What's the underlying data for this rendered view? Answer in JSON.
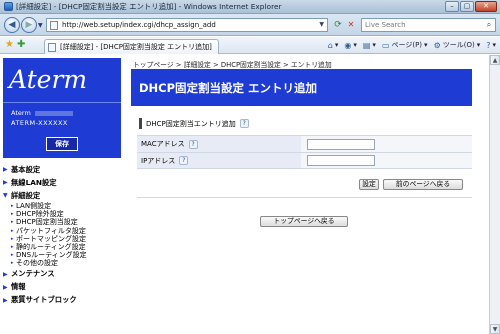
{
  "window": {
    "title": "[詳細設定] - [DHCP固定割当設定 エントリ追加] - Windows Internet Explorer",
    "minimize": "–",
    "maximize": "▢",
    "close": "✕"
  },
  "address": {
    "url": "http://web.setup/index.cgi/dhcp_assign_add",
    "search_placeholder": "Live Search"
  },
  "tab": {
    "label": "[詳細設定] - [DHCP固定割当設定 エントリ追加]"
  },
  "cmdbar": {
    "page": "ページ(P)",
    "tools": "ツール(O)"
  },
  "sidebar": {
    "logo": "Aterm",
    "device_name_label": "Aterm",
    "device_model": "ATERM-XXXXXX",
    "save": "保存",
    "menu": [
      {
        "label": "基本設定"
      },
      {
        "label": "無線LAN設定"
      },
      {
        "label": "詳細設定"
      }
    ],
    "submenu": [
      {
        "label": "LAN側設定"
      },
      {
        "label": "DHCP除外設定"
      },
      {
        "label": "DHCP固定割当設定"
      },
      {
        "label": "パケットフィルタ設定"
      },
      {
        "label": "ポートマッピング設定"
      },
      {
        "label": "静的ルーティング設定"
      },
      {
        "label": "DNSルーティング設定"
      },
      {
        "label": "その他の設定"
      }
    ],
    "menu_bottom": [
      {
        "label": "メンテナンス"
      },
      {
        "label": "情報"
      },
      {
        "label": "悪質サイトブロック"
      }
    ]
  },
  "main": {
    "breadcrumb": "トップページ > 詳細設定 > DHCP固定割当設定 > エントリ追加",
    "title": "DHCP固定割当設定 エントリ追加",
    "section_title": "DHCP固定割当エントリ追加",
    "fields": [
      {
        "label": "MACアドレス",
        "value": ""
      },
      {
        "label": "IPアドレス",
        "value": ""
      }
    ],
    "set_button": "設定",
    "back_button": "前のページへ戻る",
    "top_button": "トップページへ戻る"
  },
  "icons": {
    "help": "?",
    "menu_arrow": "▶",
    "sub_dot": "▸"
  }
}
